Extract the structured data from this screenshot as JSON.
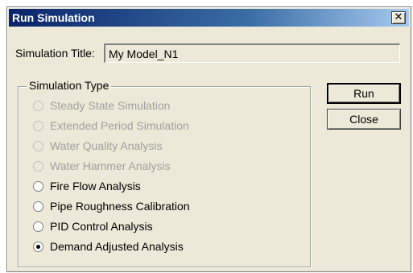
{
  "window": {
    "title": "Run Simulation",
    "close_glyph": "✕"
  },
  "simulation_title": {
    "label": "Simulation Title:",
    "value": "My Model_N1"
  },
  "simulation_type": {
    "legend": "Simulation Type",
    "options": [
      {
        "label": "Steady State Simulation",
        "enabled": false,
        "selected": false
      },
      {
        "label": "Extended Period Simulation",
        "enabled": false,
        "selected": false
      },
      {
        "label": "Water Quality Analysis",
        "enabled": false,
        "selected": false
      },
      {
        "label": "Water Hammer Analysis",
        "enabled": false,
        "selected": false
      },
      {
        "label": "Fire Flow Analysis",
        "enabled": true,
        "selected": false
      },
      {
        "label": "Pipe Roughness Calibration",
        "enabled": true,
        "selected": false
      },
      {
        "label": "PID Control Analysis",
        "enabled": true,
        "selected": false
      },
      {
        "label": "Demand Adjusted Analysis",
        "enabled": true,
        "selected": true
      }
    ]
  },
  "buttons": {
    "run": "Run",
    "close": "Close"
  }
}
